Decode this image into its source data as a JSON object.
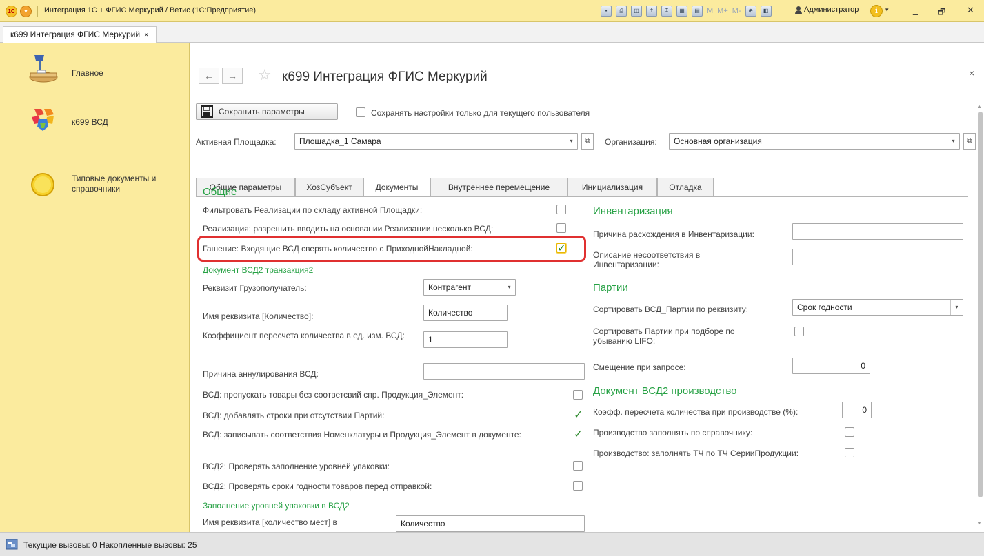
{
  "app": {
    "title": "Интеграция 1С + ФГИС Меркурий / Ветис  (1С:Предприятие)",
    "logo_text": "1С",
    "user": "Администратор",
    "info": "i",
    "window_controls": {
      "minimize": "_",
      "maximize": "🗗",
      "close": "✕"
    },
    "toolbar_m": [
      "M",
      "M+",
      "M-"
    ]
  },
  "open_tab": {
    "label": "к699 Интеграция ФГИС Меркурий",
    "close": "×"
  },
  "sidebar": {
    "items": [
      {
        "label": "Главное"
      },
      {
        "label": "к699 ВСД"
      },
      {
        "label": "Типовые документы и справочники"
      }
    ]
  },
  "form": {
    "title": "к699 Интеграция ФГИС Меркурий",
    "back": "←",
    "forward": "→",
    "star": "☆",
    "close": "×",
    "save_button": "Сохранить параметры",
    "save_for_user_label": "Сохранять настройки только для текущего пользователя",
    "save_for_user_checked": false,
    "active_site_label": "Активная Площадка:",
    "active_site_value": "Площадка_1 Самара",
    "org_label": "Организация:",
    "org_value": "Основная организация",
    "tabs": [
      "Общие параметры",
      "ХозСубъект",
      "Документы",
      "Внутреннее перемещение",
      "Инициализация",
      "Отладка"
    ],
    "active_tab": "Документы"
  },
  "left": {
    "general_title": "Общие",
    "filter_label": "Фильтровать Реализации по складу активной Площадки:",
    "filter_checked": false,
    "multi_vsd_label": "Реализация: разрешить вводить на основании Реализации несколько ВСД:",
    "multi_vsd_checked": false,
    "gashenie_label": "Гашение: Входящие ВСД сверять количество с ПриходнойНакладной:",
    "gashenie_checked": true,
    "doc_section": "Документ ВСД2 транзакция2",
    "consignee_label": "Реквизит Грузополучатель:",
    "consignee_value": "Контрагент",
    "qty_attr_label": "Имя реквизита [Количество]:",
    "qty_attr_value": "Количество",
    "coef_label": "Коэффициент пересчета количества в ед. изм. ВСД:",
    "coef_value": "1",
    "cancel_reason_label": "Причина аннулирования ВСД:",
    "cancel_reason_value": "",
    "skip_label": "ВСД: пропускать товары без соответсвий спр. Продукция_Элемент:",
    "skip_checked": false,
    "add_rows_label": "ВСД: добавлять строки при отсутствии Партий:",
    "add_rows_checked": true,
    "write_match_label": "ВСД: записывать соответствия Номенклатуры и Продукция_Элемент в документе:",
    "write_match_checked": true,
    "check_pack_label": "ВСД2: Проверять заполнение уровней упаковки:",
    "check_pack_checked": false,
    "check_expiry_label": "ВСД2: Проверять сроки годности товаров перед отправкой:",
    "check_expiry_checked": false,
    "pack_section": "Заполнение уровней упаковки в ВСД2",
    "places_label": "Имя реквизита [количество мест] в",
    "places_value": "Количество"
  },
  "right": {
    "inventory_title": "Инвентаризация",
    "discrepancy_label": "Причина расхождения в Инвентаризации:",
    "discrepancy_value": "",
    "mismatch_label": "Описание несоответствия в Инвентаризации:",
    "mismatch_value": "",
    "batches_title": "Партии",
    "sort_label": "Сортировать ВСД_Партии по реквизиту:",
    "sort_value": "Срок годности",
    "lifo_label": "Сортировать Партии при подборе по убыванию LIFO:",
    "lifo_checked": false,
    "offset_label": "Смещение при запросе:",
    "offset_value": "0",
    "prod_title": "Документ ВСД2 производство",
    "prod_coef_label": "Коэфф. пересчета количества при производстве (%):",
    "prod_coef_value": "0",
    "prod_fill_label": "Производство заполнять по справочнику:",
    "prod_fill_checked": false,
    "prod_series_label": "Производство: заполнять ТЧ по ТЧ СерииПродукции:",
    "prod_series_checked": false
  },
  "status": {
    "text": "Текущие вызовы: 0   Накопленные вызовы: 25"
  }
}
